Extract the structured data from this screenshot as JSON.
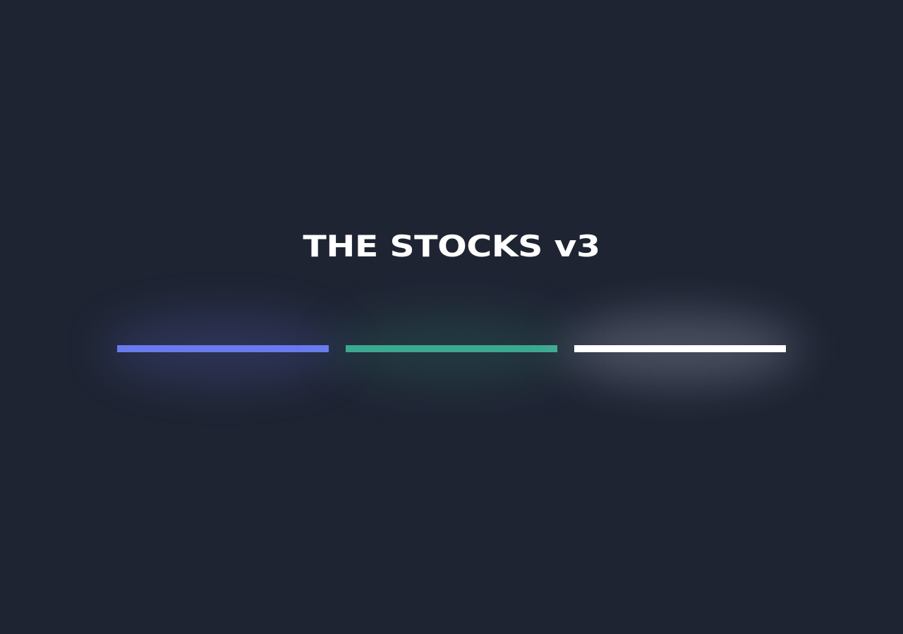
{
  "app": {
    "title": "THE STOCKS v3"
  },
  "loader": {
    "segments": [
      {
        "name": "blue",
        "color": "#6a7bf0",
        "glow": "rgba(106,123,240,0.18)"
      },
      {
        "name": "green",
        "color": "#3aa98f",
        "glow": "rgba(58,169,143,0.16)"
      },
      {
        "name": "white",
        "color": "#ffffff",
        "glow": "rgba(180,185,205,0.28)"
      }
    ]
  }
}
